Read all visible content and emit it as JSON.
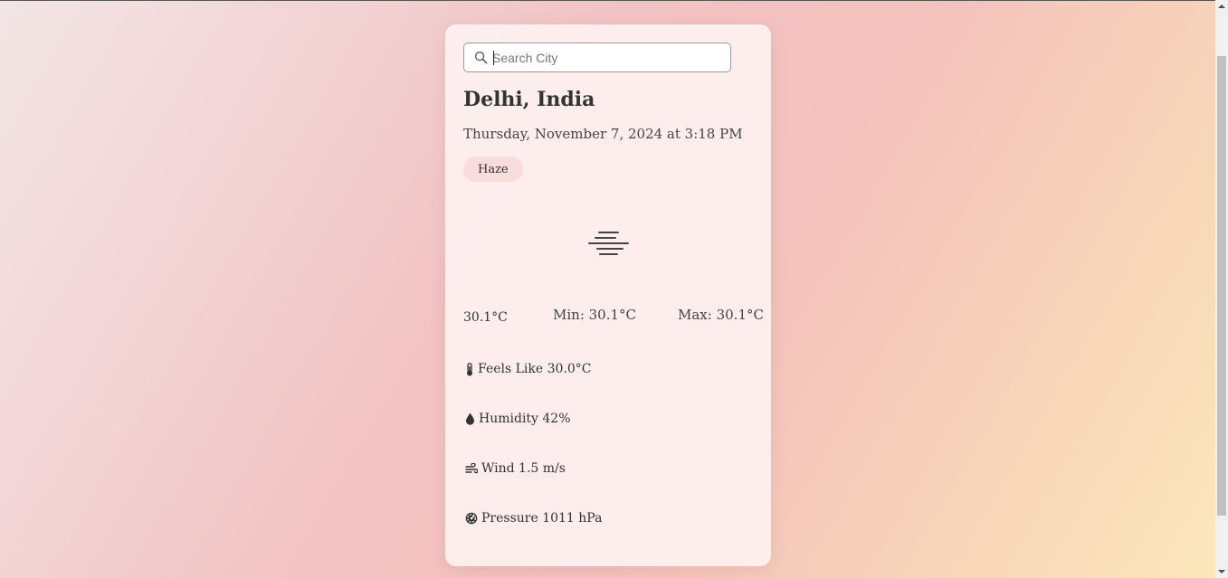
{
  "search": {
    "placeholder": "Search City",
    "value": ""
  },
  "weather": {
    "location": "Delhi, India",
    "datetime": "Thursday, November 7, 2024 at 3:18 PM",
    "condition": "Haze",
    "condition_icon": "haze-icon",
    "temperature": "30.1°C",
    "min": "Min: 30.1°C",
    "max": "Max: 30.1°C"
  },
  "details": [
    {
      "icon": "thermometer-icon",
      "label": "Feels Like 30.0°C"
    },
    {
      "icon": "droplet-icon",
      "label": "Humidity 42%"
    },
    {
      "icon": "wind-icon",
      "label": "Wind 1.5 m/s"
    },
    {
      "icon": "gauge-icon",
      "label": "Pressure 1011 hPa"
    }
  ],
  "colors": {
    "badge_background": "#fadcdc",
    "text": "#333333",
    "gradient_start": "#f3e6e6",
    "gradient_mid": "#f2c3c4",
    "gradient_end": "#fde9bd"
  }
}
